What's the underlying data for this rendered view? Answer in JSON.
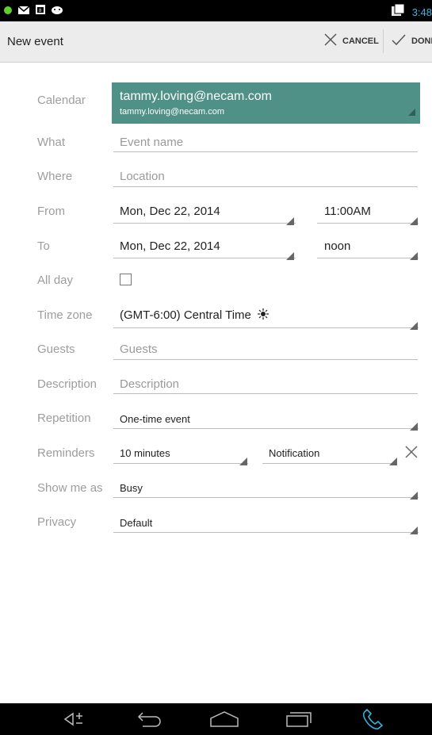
{
  "status_bar": {
    "time": "3:48",
    "icons": [
      "green-dot-icon",
      "mail-icon",
      "calendar-icon",
      "android-icon",
      "sync-icon"
    ]
  },
  "action_bar": {
    "title": "New event",
    "cancel_label": "CANCEL",
    "done_label": "DONE"
  },
  "form": {
    "calendar": {
      "label": "Calendar",
      "account": "tammy.loving@necam.com",
      "account_sub": "tammy.loving@necam.com",
      "bg_color": "#4f9186"
    },
    "what": {
      "label": "What",
      "placeholder": "Event name"
    },
    "where": {
      "label": "Where",
      "placeholder": "Location"
    },
    "from": {
      "label": "From",
      "date": "Mon, Dec 22, 2014",
      "time": "11:00AM"
    },
    "to": {
      "label": "To",
      "date": "Mon, Dec 22, 2014",
      "time": "noon"
    },
    "all_day": {
      "label": "All day",
      "checked": false
    },
    "time_zone": {
      "label": "Time zone",
      "value": "(GMT-6:00) Central Time"
    },
    "guests": {
      "label": "Guests",
      "placeholder": "Guests"
    },
    "description": {
      "label": "Description",
      "placeholder": "Description"
    },
    "repetition": {
      "label": "Repetition",
      "value": "One-time event"
    },
    "reminders": {
      "label": "Reminders",
      "minutes": "10 minutes",
      "method": "Notification"
    },
    "show_me_as": {
      "label": "Show me as",
      "value": "Busy"
    },
    "privacy": {
      "label": "Privacy",
      "value": "Default"
    }
  },
  "nav_bar": {
    "icons": [
      "volume-icon",
      "back-icon",
      "home-icon",
      "recents-icon",
      "phone-icon"
    ]
  }
}
